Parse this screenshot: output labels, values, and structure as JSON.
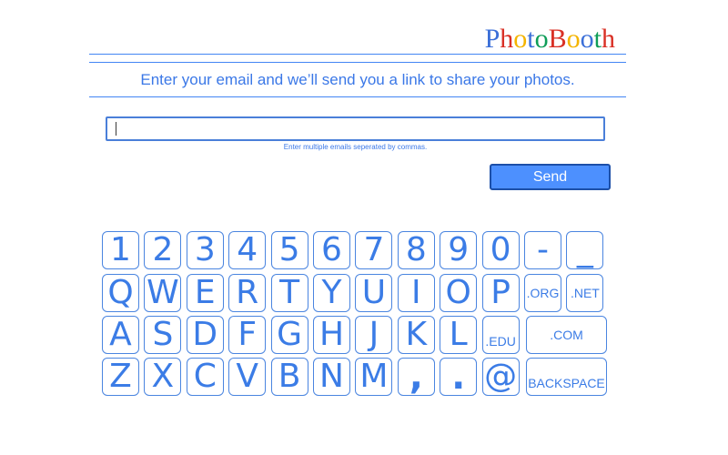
{
  "logo": {
    "letters": [
      {
        "ch": "P",
        "color": "#3b6fd8"
      },
      {
        "ch": "h",
        "color": "#d93025"
      },
      {
        "ch": "o",
        "color": "#f4b400"
      },
      {
        "ch": "t",
        "color": "#3b6fd8"
      },
      {
        "ch": "o",
        "color": "#0f9d58"
      },
      {
        "ch": "B",
        "color": "#d93025"
      },
      {
        "ch": "o",
        "color": "#f4b400"
      },
      {
        "ch": "o",
        "color": "#3b6fd8"
      },
      {
        "ch": "t",
        "color": "#0f9d58"
      },
      {
        "ch": "h",
        "color": "#d93025"
      }
    ]
  },
  "instruction": "Enter your email and we’ll send you a link to share your photos.",
  "email": {
    "value": "",
    "placeholder": ""
  },
  "hint": "Enter multiple emails seperated by commas.",
  "send_label": "Send",
  "colors": {
    "accent": "#4285f4",
    "button": "#4d90fe",
    "key_text": "#3b7ce6"
  },
  "keyboard": {
    "rows": [
      [
        {
          "label": "1",
          "name": "key-1"
        },
        {
          "label": "2",
          "name": "key-2"
        },
        {
          "label": "3",
          "name": "key-3"
        },
        {
          "label": "4",
          "name": "key-4"
        },
        {
          "label": "5",
          "name": "key-5"
        },
        {
          "label": "6",
          "name": "key-6"
        },
        {
          "label": "7",
          "name": "key-7"
        },
        {
          "label": "8",
          "name": "key-8"
        },
        {
          "label": "9",
          "name": "key-9"
        },
        {
          "label": "0",
          "name": "key-0"
        },
        {
          "label": "-",
          "name": "key-hyphen"
        },
        {
          "label": "_",
          "name": "key-underscore"
        }
      ],
      [
        {
          "label": "Q",
          "name": "key-q"
        },
        {
          "label": "W",
          "name": "key-w"
        },
        {
          "label": "E",
          "name": "key-e"
        },
        {
          "label": "R",
          "name": "key-r"
        },
        {
          "label": "T",
          "name": "key-t"
        },
        {
          "label": "Y",
          "name": "key-y"
        },
        {
          "label": "U",
          "name": "key-u"
        },
        {
          "label": "I",
          "name": "key-i"
        },
        {
          "label": "O",
          "name": "key-o"
        },
        {
          "label": "P",
          "name": "key-p"
        },
        {
          "label": ".ORG",
          "name": "key-dot-org"
        },
        {
          "label": ".NET",
          "name": "key-dot-net"
        }
      ],
      [
        {
          "label": "A",
          "name": "key-a"
        },
        {
          "label": "S",
          "name": "key-s"
        },
        {
          "label": "D",
          "name": "key-d"
        },
        {
          "label": "F",
          "name": "key-f"
        },
        {
          "label": "G",
          "name": "key-g"
        },
        {
          "label": "H",
          "name": "key-h"
        },
        {
          "label": "J",
          "name": "key-j"
        },
        {
          "label": "K",
          "name": "key-k"
        },
        {
          "label": "L",
          "name": "key-l"
        },
        {
          "label": ".EDU",
          "name": "key-dot-edu"
        },
        {
          "label": ".COM",
          "name": "key-dot-com"
        }
      ],
      [
        {
          "label": "Z",
          "name": "key-z"
        },
        {
          "label": "X",
          "name": "key-x"
        },
        {
          "label": "C",
          "name": "key-c"
        },
        {
          "label": "V",
          "name": "key-v"
        },
        {
          "label": "B",
          "name": "key-b"
        },
        {
          "label": "N",
          "name": "key-n"
        },
        {
          "label": "M",
          "name": "key-m"
        },
        {
          "label": ",",
          "name": "key-comma"
        },
        {
          "label": ".",
          "name": "key-period"
        },
        {
          "label": "@",
          "name": "key-at"
        },
        {
          "label": "BACKSPACE",
          "name": "key-backspace"
        }
      ]
    ]
  }
}
